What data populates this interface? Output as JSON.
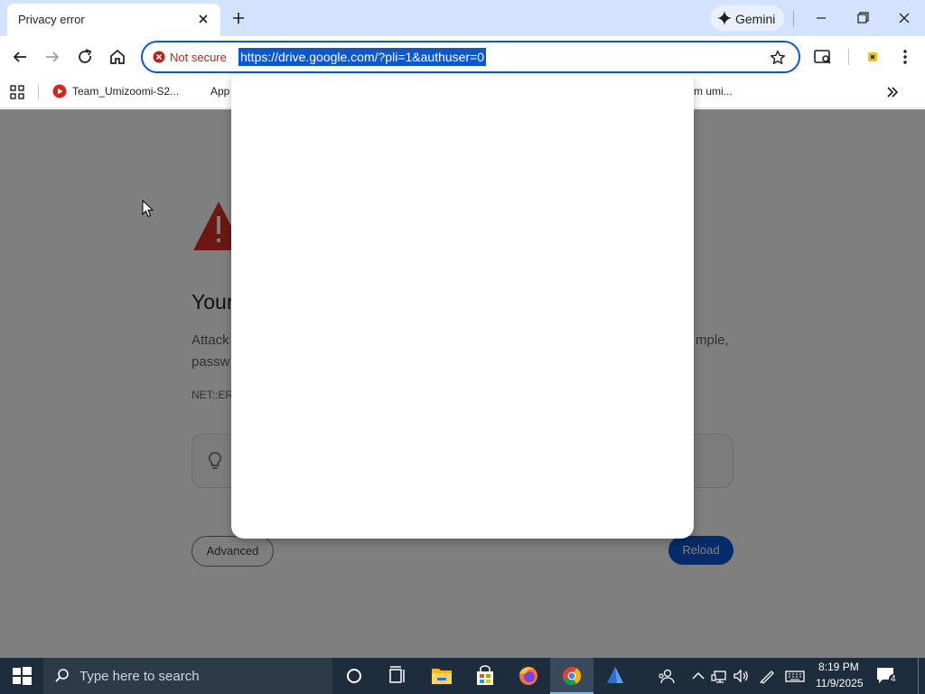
{
  "tab": {
    "title": "Privacy error"
  },
  "gemini": {
    "label": "Gemini"
  },
  "omnibox": {
    "security_label": "Not secure",
    "url": "https://drive.google.com/?pli=1&authuser=0"
  },
  "bookmarks": {
    "items": [
      {
        "label": "Team_Umizoomi-S2..."
      },
      {
        "label": "App"
      },
      {
        "label": "m umi..."
      }
    ]
  },
  "page": {
    "heading": "Your",
    "body_line1": "Attack",
    "body_line2": "passw",
    "body_right": "mple,",
    "error_code": "NET::ER",
    "advanced_label": "Advanced",
    "reload_label": "Reload"
  },
  "taskbar": {
    "search_placeholder": "Type here to search",
    "time": "8:19 PM",
    "date": "11/9/2025",
    "notification_count": "4"
  },
  "colors": {
    "accent": "#0b57d0",
    "tabstrip": "#d3e3fd",
    "not_secure": "#b3261e",
    "taskbar": "#1e2d3e"
  }
}
